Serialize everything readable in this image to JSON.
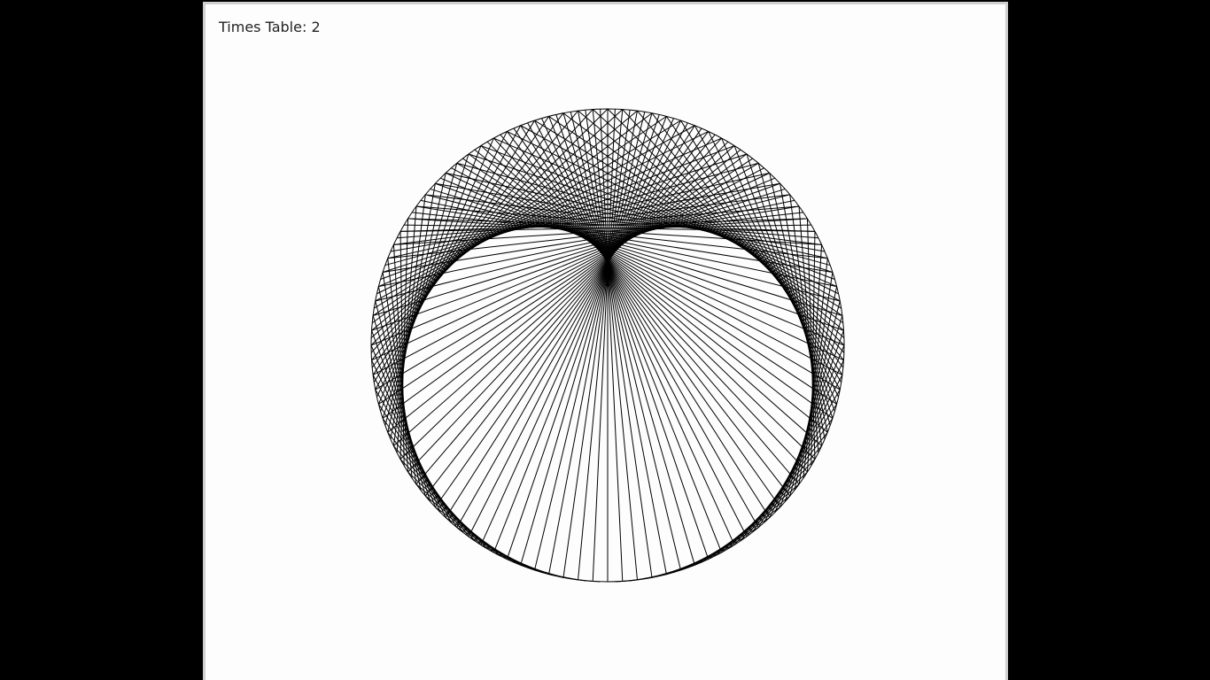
{
  "window": {
    "caption_prefix": "Times Table: ",
    "multiplier_text": "2"
  },
  "visualization": {
    "multiplier": 2,
    "points": 200,
    "stroke_color": "#000000",
    "background": "#fdfdfd"
  },
  "colors": {
    "desktop_background": "#000000",
    "window_border": "#cfcfcf",
    "text": "#222222"
  }
}
